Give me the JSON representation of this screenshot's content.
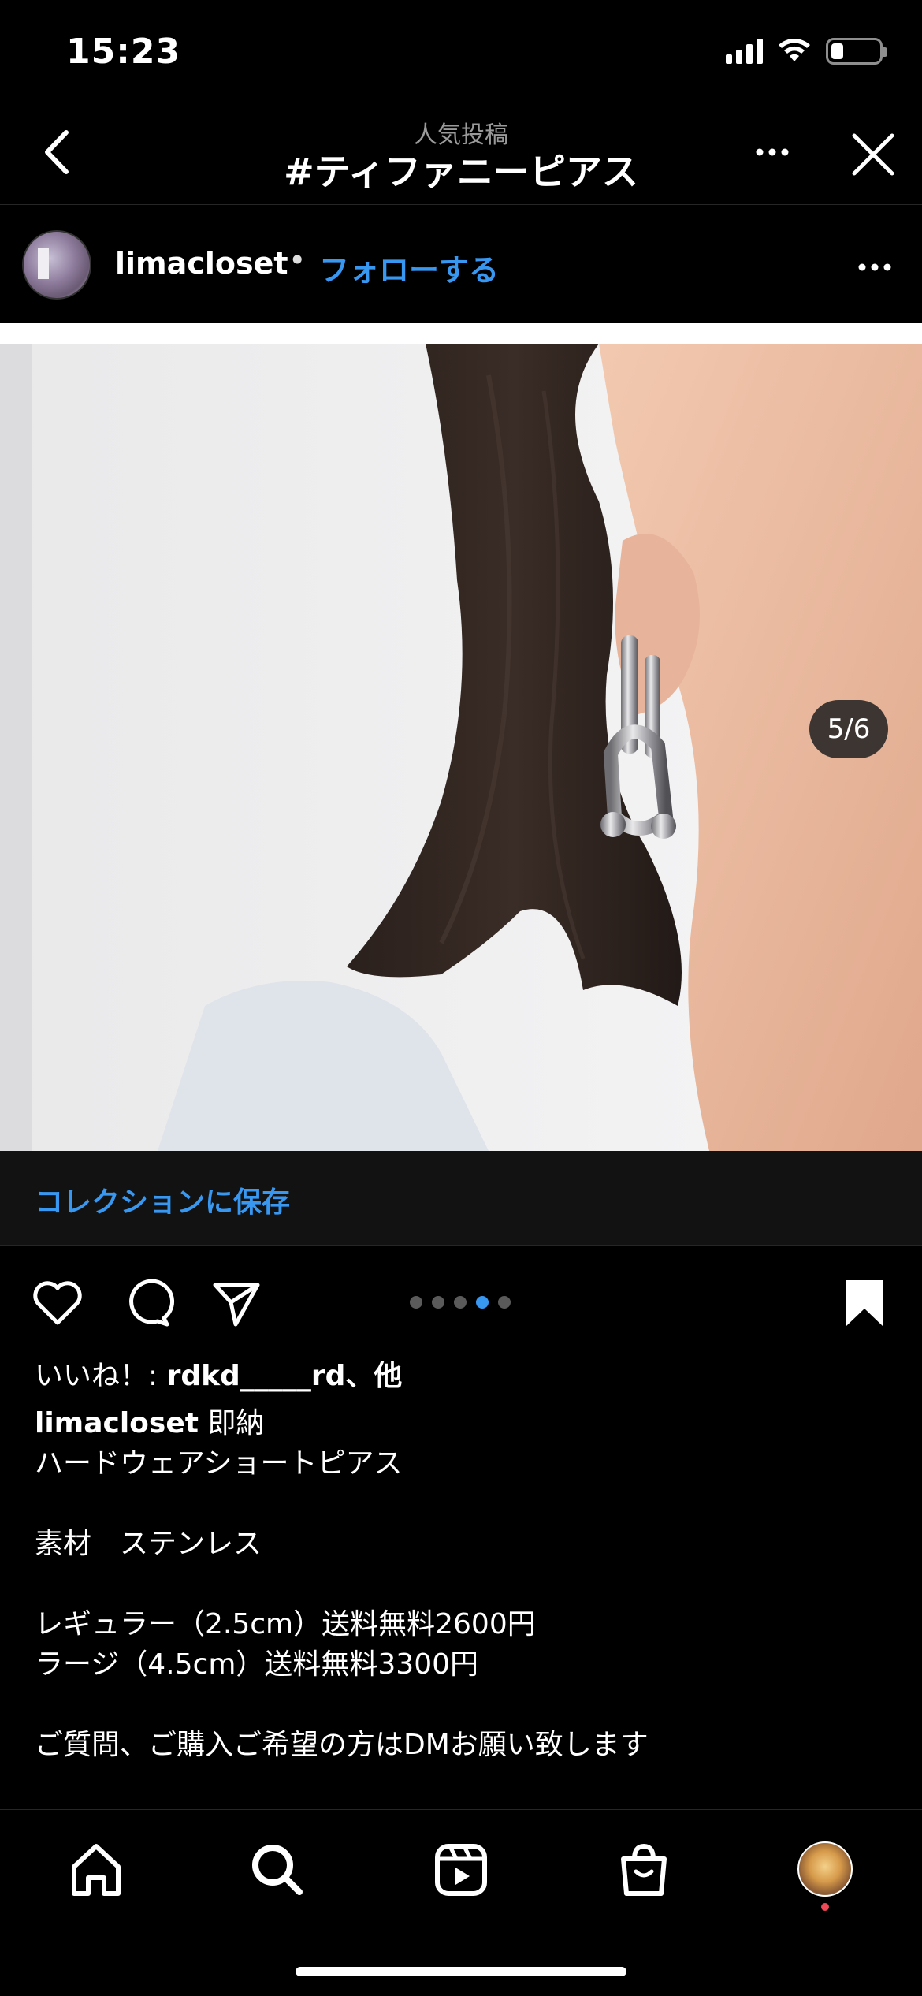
{
  "status_bar": {
    "time": "15:23",
    "battery_level": 0.25
  },
  "nav": {
    "subtitle": "人気投稿",
    "title": "#ティファニーピアス"
  },
  "post": {
    "username": "limacloset",
    "separator": "•",
    "follow_label": "フォローする",
    "page_indicator": "5/6",
    "carousel": {
      "total": 5,
      "active_index": 3
    }
  },
  "collection": {
    "label": "コレクションに保存"
  },
  "likes": {
    "prefix": "いいね！: ",
    "user": "rdkd_____rd",
    "suffix": "、他"
  },
  "caption": {
    "username": "limacloset",
    "first_line": " 即納",
    "lines": [
      "ハードウェアショートピアス",
      "",
      "素材　ステンレス",
      "",
      "レギュラー（2.5cm）送料無料2600円",
      "ラージ（4.5cm）送料無料3300円",
      "",
      "ご質問、ご購入ご希望の方はDMお願い致します"
    ]
  },
  "colors": {
    "accent": "#3897f0",
    "background": "#000000",
    "notification": "#ed4956"
  },
  "icons": {
    "back": "chevron-left-icon",
    "more": "more-horizontal-icon",
    "close": "close-icon",
    "like": "heart-icon",
    "comment": "comment-icon",
    "share": "send-icon",
    "save": "bookmark-filled-icon",
    "home": "home-icon",
    "search": "search-icon",
    "reels": "reels-icon",
    "shop": "shopping-bag-icon"
  }
}
